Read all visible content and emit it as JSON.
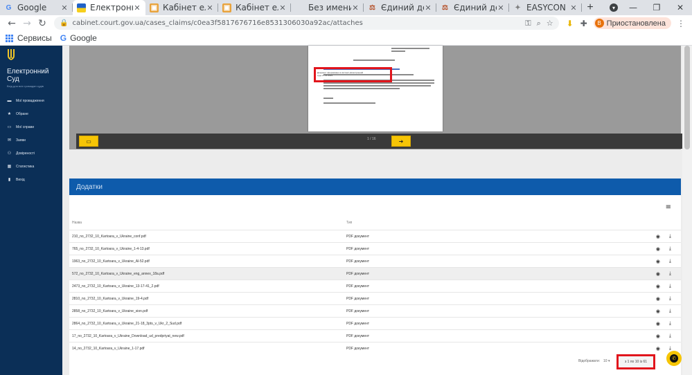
{
  "browser": {
    "tabs": [
      {
        "label": "Google",
        "icon": "google-icon"
      },
      {
        "label": "Електронн",
        "icon": "ukraine-flag-icon"
      },
      {
        "label": "Кабінет ел",
        "icon": "cabinet-icon"
      },
      {
        "label": "Кабінет ел",
        "icon": "cabinet-icon"
      },
      {
        "label": "Без имени",
        "icon": "blank-icon"
      },
      {
        "label": "Єдиний де",
        "icon": "court-icon"
      },
      {
        "label": "Єдиний де",
        "icon": "court-icon"
      },
      {
        "label": "EASYCON",
        "icon": "easycon-icon"
      }
    ],
    "url": "cabinet.court.gov.ua/cases_claims/c0ea3f5817676716e8531306030a92ac/attaches",
    "profile_label": "Приостановлена",
    "profile_initial": "В",
    "bookmarks": {
      "apps": "Сервисы",
      "google": "Google"
    }
  },
  "sidebar": {
    "title": "Електронний Суд",
    "subtitle": "Вхід для всіх громадян судів",
    "items": [
      {
        "label": "Мої провадження",
        "icon": "folder-icon"
      },
      {
        "label": "Обране",
        "icon": "star-icon"
      },
      {
        "label": "Мої справи",
        "icon": "cases-icon"
      },
      {
        "label": "Заяви",
        "icon": "mail-icon"
      },
      {
        "label": "Довіреності",
        "icon": "users-icon"
      },
      {
        "label": "Статистика",
        "icon": "chart-icon"
      },
      {
        "label": "Вихід",
        "icon": "exit-icon"
      }
    ]
  },
  "pdf": {
    "pager": "1 / 16",
    "highlight_text": "Документ сформовано в системі «Електронний суд» 27.01.2021"
  },
  "attachments": {
    "title": "Додатки",
    "col_name": "Назва",
    "col_type": "Тип",
    "rows": [
      {
        "name": "210_no_2732_10_Kartoara_v_Ukraine_conf.pdf",
        "type": "PDF документ"
      },
      {
        "name": "765_no_2732_10_Kartoara_v_Ukraine_1-4-13.pdf",
        "type": "PDF документ"
      },
      {
        "name": "1963_no_2732_10_Kartoara_v_Ukraine_Al-52.pdf",
        "type": "PDF документ"
      },
      {
        "name": "572_no_2732_10_Kartoara_v_Ukraine_eng_annex_18a.pdf",
        "type": "PDF документ"
      },
      {
        "name": "2473_no_2732_10_Kartoara_v_Ukraine_13-17-41_2.pdf",
        "type": "PDF документ"
      },
      {
        "name": "2810_no_2732_10_Kartoara_v_Ukraine_19-4.pdf",
        "type": "PDF документ"
      },
      {
        "name": "2858_no_2732_10_Kartoara_v_Ukraine_sion.pdf",
        "type": "PDF документ"
      },
      {
        "name": "2864_no_2732_10_Kartoara_v_Ukraine_21-18_3pts_v_Ukr_2_Sud.pdf",
        "type": "PDF документ"
      },
      {
        "name": "17_no_2732_10_Kartoara_v_Ukraine_Download_ud_predpriyat_new.pdf",
        "type": "PDF документ"
      },
      {
        "name": "14_no_2732_10_Kartoara_v_Ukraine_1-17.pdf",
        "type": "PDF документ"
      }
    ],
    "per_page_label": "Відображати:",
    "per_page_value": "10",
    "range": "з 1 по 10 із 61"
  }
}
